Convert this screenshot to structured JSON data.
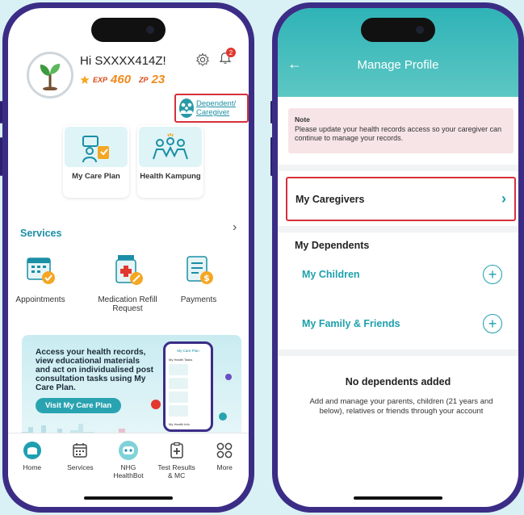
{
  "left": {
    "greeting": "Hi SXXXX414Z!",
    "exp_label": "EXP",
    "exp_value": "460",
    "zp_label": "ZP",
    "zp_value": "23",
    "notification_count": "2",
    "dependent_link": "Dependent/ Caregiver",
    "quick_cards": [
      {
        "label": "My Care Plan"
      },
      {
        "label": "Health Kampung"
      }
    ],
    "services_title": "Services",
    "services": [
      {
        "label": "Appointments"
      },
      {
        "label": "Medication Refill Request"
      },
      {
        "label": "Payments"
      }
    ],
    "banner": {
      "text": "Access your health records, view educational materials and act on individualised post consultation tasks using My Care Plan.",
      "button": "Visit My Care Plan",
      "phone_title": "My Care Plan",
      "phone_sub1": "My Health Tasks",
      "phone_sub2": "My Health Info"
    },
    "tabs": [
      {
        "label": "Home"
      },
      {
        "label": "Services"
      },
      {
        "label": "NHG HealthBot"
      },
      {
        "label": "Test Results & MC"
      },
      {
        "label": "More"
      }
    ]
  },
  "right": {
    "title": "Manage Profile",
    "note_title": "Note",
    "note_text": "Please update your health records access so your caregiver can continue to manage your records.",
    "caregivers_label": "My Caregivers",
    "dependents_title": "My Dependents",
    "children_label": "My Children",
    "family_label": "My Family & Friends",
    "empty_title": "No dependents added",
    "empty_text": "Add and manage your parents, children (21 years and below), relatives or friends through your account"
  },
  "colors": {
    "teal": "#1ea0ad",
    "highlight": "#d6303b",
    "phone_frame": "#3b2d86"
  }
}
